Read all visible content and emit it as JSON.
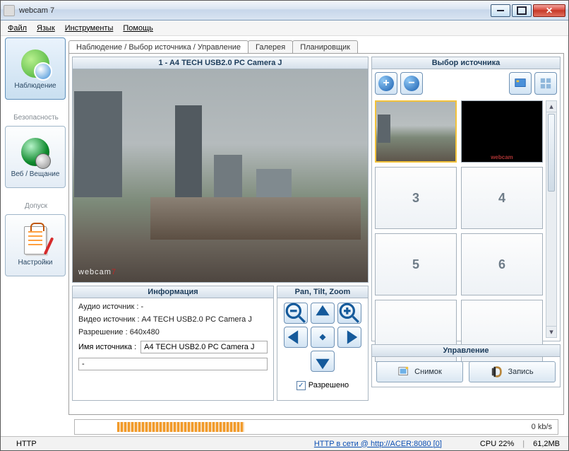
{
  "window": {
    "title": "webcam 7"
  },
  "menu": {
    "file": "Файл",
    "lang": "Язык",
    "tools": "Инструменты",
    "help": "Помощь"
  },
  "sidebar": {
    "surveil": "Наблюдение",
    "security": "Безопасность",
    "web": "Веб / Вещание",
    "access": "Допуск",
    "settings": "Настройки"
  },
  "tabs": {
    "main": "Наблюдение / Выбор источника / Управление",
    "gallery": "Галерея",
    "scheduler": "Планировщик"
  },
  "camera": {
    "title": "1 - A4 TECH USB2.0 PC Camera J",
    "watermark1": "webcam",
    "watermark2": "7"
  },
  "info": {
    "title": "Информация",
    "audio": "Аудио источник : -",
    "video": "Видео источник : A4 TECH USB2.0 PC Camera J",
    "res": "Разрешение : 640x480",
    "name_label": "Имя источника :",
    "name_value": "A4 TECH USB2.0 PC Camera J",
    "extra": "-"
  },
  "ptz": {
    "title": "Pan, Tilt, Zoom",
    "allowed": "Разрешено"
  },
  "source": {
    "title": "Выбор источника",
    "slots": {
      "s3": "3",
      "s4": "4",
      "s5": "5",
      "s6": "6"
    }
  },
  "control": {
    "title": "Управление",
    "snapshot": "Снимок",
    "record": "Запись"
  },
  "bw": {
    "rate": "0 kb/s"
  },
  "status": {
    "http": "HTTP",
    "link": "HTTP в сети @ http://ACER:8080 [0]",
    "cpu": "CPU 22%",
    "mem": "61,2MB"
  }
}
